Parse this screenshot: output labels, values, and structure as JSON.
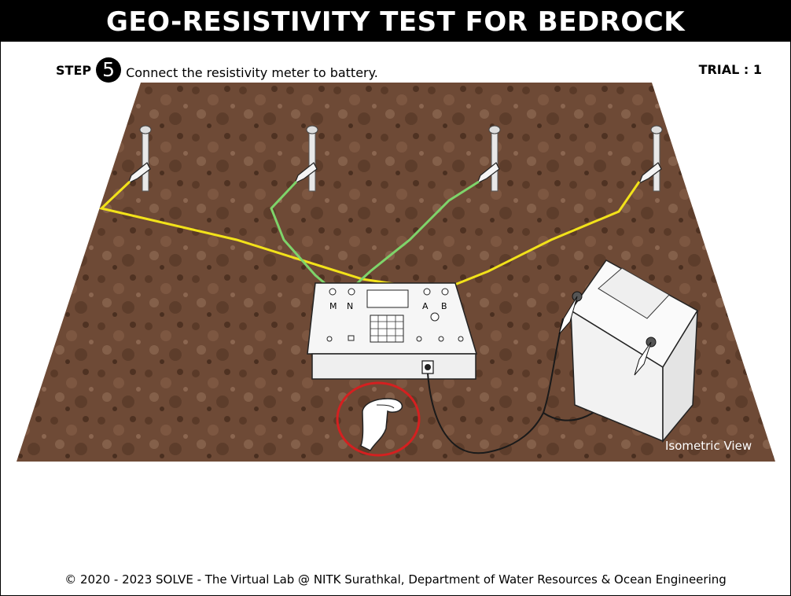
{
  "header": {
    "title": "GEO-RESISTIVITY TEST FOR BEDROCK"
  },
  "step": {
    "label": "STEP",
    "number": "5",
    "instruction": "Connect the resistivity meter to battery."
  },
  "trial": {
    "label": "TRIAL : 1"
  },
  "scene": {
    "view_label": "Isometric View",
    "meter_terminals": [
      "M",
      "N",
      "A",
      "B"
    ],
    "wire_colors": {
      "current_wire": "#f2e21a",
      "potential_wire": "#7ed46a",
      "battery_cable": "#1a1a1a"
    },
    "ground_color": "#6e4a36",
    "highlight_color": "#d42020",
    "icons": [
      "electrode-stake-icon",
      "alligator-clip-icon",
      "resistivity-meter-icon",
      "battery-icon",
      "hand-pointer-icon"
    ]
  },
  "footer": {
    "copyright": "© 2020 - 2023 SOLVE - The Virtual Lab @ NITK Surathkal, Department of Water Resources & Ocean Engineering"
  }
}
